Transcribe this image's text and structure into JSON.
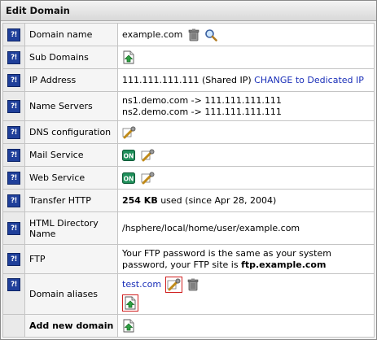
{
  "header": {
    "title": "Edit Domain"
  },
  "help_label": "?!",
  "rows": {
    "domain_name": {
      "label": "Domain name",
      "value": "example.com"
    },
    "sub_domains": {
      "label": "Sub Domains"
    },
    "ip_address": {
      "label": "IP Address",
      "ip": "111.111.111.111",
      "type": "(Shared IP)",
      "change_link": "CHANGE to Dedicated IP"
    },
    "name_servers": {
      "label": "Name Servers",
      "ns1": "ns1.demo.com -> 111.111.111.111",
      "ns2": "ns2.demo.com -> 111.111.111.111"
    },
    "dns": {
      "label": "DNS configuration"
    },
    "mail": {
      "label": "Mail Service",
      "state": "ON"
    },
    "web": {
      "label": "Web Service",
      "state": "ON"
    },
    "transfer": {
      "label": "Transfer HTTP",
      "amount": "254 KB",
      "rest": " used (since Apr 28, 2004)"
    },
    "html_dir": {
      "label": "HTML Directory Name",
      "value": "/hsphere/local/home/user/example.com"
    },
    "ftp": {
      "label": "FTP",
      "text": "Your FTP password is the same as your system password, your FTP site is ",
      "site": "ftp.example.com"
    },
    "aliases": {
      "label": "Domain aliases",
      "alias": "test.com"
    },
    "add_new": {
      "label": "Add new domain"
    }
  },
  "colors": {
    "link": "#1a2fb8",
    "help_bg": "#1f3f9a",
    "on_badge": "#1f8f5a",
    "highlight": "#d02020"
  },
  "icons": [
    "help-icon",
    "trash-icon",
    "magnifier-icon",
    "add-page-icon",
    "edit-wrench-icon",
    "on-badge-icon"
  ]
}
